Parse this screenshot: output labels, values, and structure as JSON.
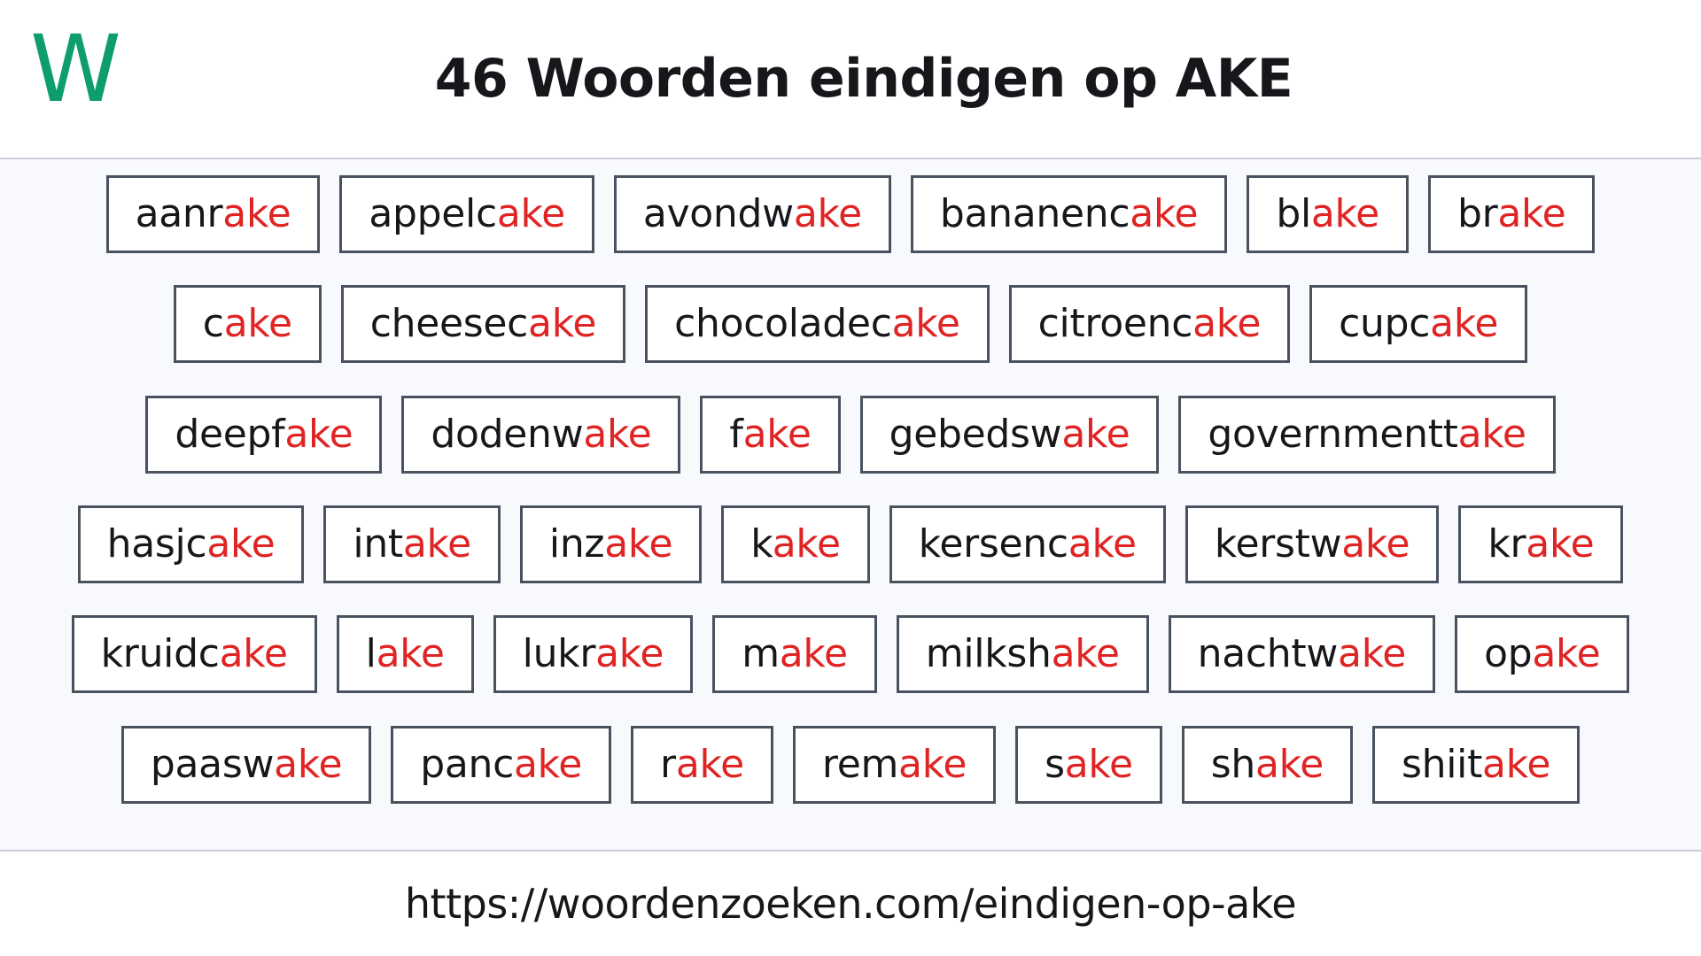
{
  "header": {
    "logo_text": "W",
    "logo_color": "#0e9e6e",
    "title": "46 Woorden eindigen op AKE"
  },
  "suffix": "ake",
  "highlight_color": "#e02424",
  "rows": [
    [
      {
        "prefix": "aanr",
        "suffix": "ake"
      },
      {
        "prefix": "appelc",
        "suffix": "ake"
      },
      {
        "prefix": "avondw",
        "suffix": "ake"
      },
      {
        "prefix": "bananenc",
        "suffix": "ake"
      },
      {
        "prefix": "bl",
        "suffix": "ake"
      },
      {
        "prefix": "br",
        "suffix": "ake"
      }
    ],
    [
      {
        "prefix": "c",
        "suffix": "ake"
      },
      {
        "prefix": "cheesec",
        "suffix": "ake"
      },
      {
        "prefix": "chocoladec",
        "suffix": "ake"
      },
      {
        "prefix": "citroenc",
        "suffix": "ake"
      },
      {
        "prefix": "cupc",
        "suffix": "ake"
      }
    ],
    [
      {
        "prefix": "deepf",
        "suffix": "ake"
      },
      {
        "prefix": "dodenw",
        "suffix": "ake"
      },
      {
        "prefix": "f",
        "suffix": "ake"
      },
      {
        "prefix": "gebedsw",
        "suffix": "ake"
      },
      {
        "prefix": "governmentt",
        "suffix": "ake"
      }
    ],
    [
      {
        "prefix": "hasjc",
        "suffix": "ake"
      },
      {
        "prefix": "int",
        "suffix": "ake"
      },
      {
        "prefix": "inz",
        "suffix": "ake"
      },
      {
        "prefix": "k",
        "suffix": "ake"
      },
      {
        "prefix": "kersenc",
        "suffix": "ake"
      },
      {
        "prefix": "kerstw",
        "suffix": "ake"
      },
      {
        "prefix": "kr",
        "suffix": "ake"
      }
    ],
    [
      {
        "prefix": "kruidc",
        "suffix": "ake"
      },
      {
        "prefix": "l",
        "suffix": "ake"
      },
      {
        "prefix": "lukr",
        "suffix": "ake"
      },
      {
        "prefix": "m",
        "suffix": "ake"
      },
      {
        "prefix": "milksh",
        "suffix": "ake"
      },
      {
        "prefix": "nachtw",
        "suffix": "ake"
      },
      {
        "prefix": "op",
        "suffix": "ake"
      }
    ],
    [
      {
        "prefix": "paasw",
        "suffix": "ake"
      },
      {
        "prefix": "panc",
        "suffix": "ake"
      },
      {
        "prefix": "r",
        "suffix": "ake"
      },
      {
        "prefix": "rem",
        "suffix": "ake"
      },
      {
        "prefix": "s",
        "suffix": "ake"
      },
      {
        "prefix": "sh",
        "suffix": "ake"
      },
      {
        "prefix": "shiit",
        "suffix": "ake"
      }
    ]
  ],
  "footer": {
    "url": "https://woordenzoeken.com/eindigen-op-ake"
  }
}
